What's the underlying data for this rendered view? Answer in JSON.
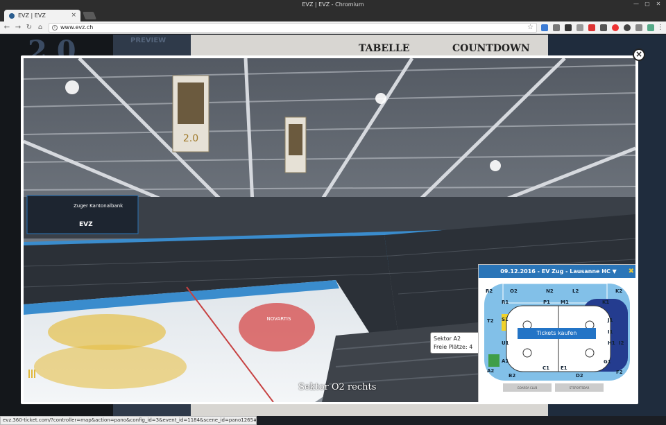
{
  "window": {
    "title": "EVZ | EVZ - Chromium"
  },
  "tab": {
    "title": "EVZ | EVZ",
    "close": "×"
  },
  "address": {
    "url": "www.evz.ch"
  },
  "background": {
    "logo": "2.0",
    "preview": "PREVIEW",
    "nav": [
      "TABELLE",
      "COUNTDOWN"
    ]
  },
  "modal": {
    "close": "×"
  },
  "pano": {
    "scene_label": "Sektor O2 rechts",
    "banner_text": "2.0",
    "scoreboard_text": "EVZ",
    "board_text": "Zuger Kantonalbank",
    "ice_text": "NOVARTIS"
  },
  "tooltip": {
    "line1": "Sektor A2",
    "line2": "Freie Plätze: 4"
  },
  "seatmap": {
    "header": "09.12.2016 - EV Zug - Lausanne HC ▼",
    "close": "✖",
    "buy_label": "Tickets kaufen",
    "sectors_top": [
      "R2",
      "O2",
      "N2",
      "L2",
      "K2"
    ],
    "sectors_top_inner": [
      "R1",
      "P1",
      "M1",
      "K1"
    ],
    "sectors_left": [
      "T2",
      "S1",
      "U1",
      "A1",
      "A2"
    ],
    "sectors_right": [
      "J1",
      "I1",
      "H1",
      "I2",
      "G1",
      "F2"
    ],
    "sectors_bottom": [
      "B2",
      "C1",
      "E1",
      "D2"
    ],
    "bottom_labels": [
      "GOAREA CLUB",
      "STSPORTSBAR"
    ],
    "colors": {
      "blue": "#2a75b8",
      "light": "#82c0e8",
      "dark": "#243c8f",
      "yellow": "#f0d22a",
      "green": "#3f9e48"
    }
  },
  "status": {
    "url": "evz.360-ticket.com/?controller=map&action=pano&config_id=3&event_id=1184&scene_id=pano1265#"
  }
}
